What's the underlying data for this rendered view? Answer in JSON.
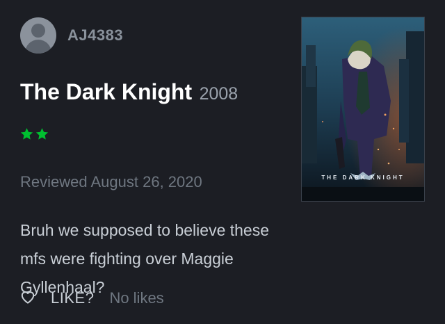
{
  "user": {
    "username": "AJ4383",
    "avatar_icon": "default-avatar-icon"
  },
  "film": {
    "title": "The Dark Knight",
    "year": "2008",
    "poster_caption": "THE DARK KNIGHT"
  },
  "rating": {
    "stars": 2,
    "max": 5,
    "color": "#00c030",
    "icon": "star-icon"
  },
  "review": {
    "date_text": "Reviewed August 26, 2020",
    "body": "Bruh we supposed to believe these mfs were fighting over Maggie Gyllenhaal?"
  },
  "like": {
    "label": "LIKE?",
    "count_text": "No likes",
    "icon": "heart-outline-icon"
  },
  "colors": {
    "background": "#1c1e24",
    "accent_green": "#00c030"
  }
}
